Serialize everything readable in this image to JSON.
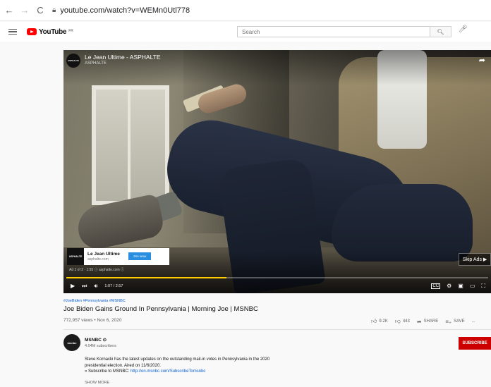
{
  "browser": {
    "back_icon": "arrow-left-icon",
    "forward_icon": "arrow-right-icon",
    "reload_icon": "reload-icon",
    "url": "youtube.com/watch?v=WEMn0Utl778"
  },
  "header": {
    "logo_text": "YouTube",
    "logo_region": "FR",
    "search_placeholder": "Search"
  },
  "player": {
    "ad_title": "Le Jean Ultime - ASPHALTE",
    "ad_channel": "ASPHALTE",
    "ad_logo_text": "ASPHALTE",
    "ad_card": {
      "name": "Le Jean Ultime",
      "url": "asphalte.com",
      "button": "J'en veux"
    },
    "ad_info": "Ad 1 of 2 · 1:55  ⓘ  asphalte.com ⓘ",
    "skip_label": "Skip Ads ▶",
    "time": "1:07 / 2:57",
    "progress_fraction": 0.38,
    "accent_color": "#ffcc00"
  },
  "video": {
    "hashtags": "#JoeBiden #Pennsylvania #MSNBC",
    "title": "Joe Biden Gains Ground In Pennsylvania | Morning Joe | MSNBC",
    "views": "772,957 views • Nov 6, 2020",
    "likes": "9.2K",
    "dislikes": "443",
    "share": "SHARE",
    "save": "SAVE",
    "more": "..."
  },
  "channel": {
    "avatar_text": "msnbc",
    "name": "MSNBC ⊙",
    "subscribers": "4.04M subscribers",
    "subscribe": "SUBSCRIBE",
    "subscribe_color": "#cc0000"
  },
  "description": {
    "line1": "Steve Kornacki has the latest updates on the outstanding mail-in votes in Pennsylvania in the 2020",
    "line2": "presidential election. Aired on 11/6/2020.",
    "line3_prefix": "» Subscribe to MSNBC: ",
    "line3_link": "http://on.msnbc.com/SubscribeTomsnbc",
    "show_more": "SHOW MORE"
  }
}
